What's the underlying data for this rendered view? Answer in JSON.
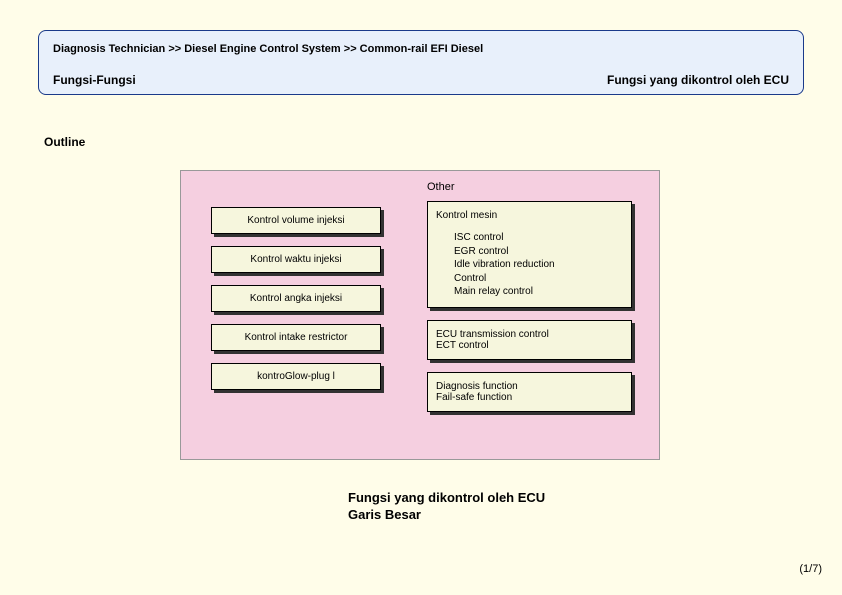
{
  "header": {
    "breadcrumb": "Diagnosis Technician >> Diesel Engine Control System >> Common-rail EFI Diesel",
    "left_title": "Fungsi-Fungsi",
    "right_title": "Fungsi yang dikontrol oleh ECU"
  },
  "outline_label": "Outline",
  "diagram": {
    "other_label": "Other",
    "left_items": [
      "Kontrol volume injeksi",
      "Kontrol waktu injeksi",
      "Kontrol angka injeksi",
      "Kontrol intake restrictor",
      "kontroGlow-plug l"
    ],
    "right_box1": {
      "title": "Kontrol mesin",
      "items": [
        "ISC control",
        "EGR control",
        "Idle vibration reduction",
        "Control",
        "Main relay control"
      ]
    },
    "right_box2": {
      "items": [
        "ECU transmission control",
        "ECT control"
      ]
    },
    "right_box3": {
      "items": [
        "Diagnosis function",
        "Fail-safe function"
      ]
    }
  },
  "bottom_title_line1": "Fungsi yang dikontrol oleh ECU",
  "bottom_title_line2": "Garis Besar",
  "pager": "(1/7)"
}
